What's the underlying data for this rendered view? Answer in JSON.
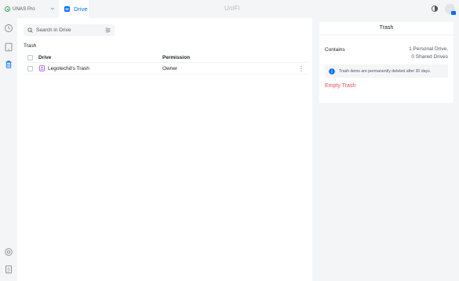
{
  "topbar": {
    "device_name": "UNAS Pro",
    "app_tab_label": "Drive",
    "logo_text": "UniFi"
  },
  "rail": {
    "items": [
      {
        "icon": "restore-clock-icon"
      },
      {
        "icon": "tablet-icon"
      },
      {
        "icon": "trash-icon"
      },
      {
        "icon": "settings-icon"
      },
      {
        "icon": "clipboard-icon"
      }
    ]
  },
  "main": {
    "search": {
      "placeholder": "Search in Drive"
    },
    "section_title": "Trash",
    "table": {
      "columns": [
        "Drive",
        "Permission"
      ],
      "rows": [
        {
          "drive": "Legotechd's Trash",
          "permission": "Owner"
        }
      ]
    }
  },
  "panel": {
    "title": "Trash",
    "contains_label": "Contains",
    "contains_values": [
      "1 Personal Drive,",
      "0 Shared Drives"
    ],
    "info_text": "Trash items are permanently deleted after 30 days.",
    "empty_trash_label": "Empty Trash"
  },
  "colors": {
    "accent": "#006fff",
    "danger": "#ee4b55",
    "device_status": "#2fa84f",
    "drive_icon": "#9b51e0"
  }
}
